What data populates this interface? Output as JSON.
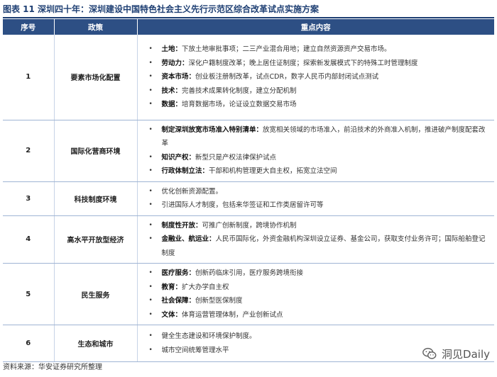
{
  "header": {
    "title": "图表 11  深圳四十年：深圳建设中国特色社会主义先行示范区综合改革试点实施方案"
  },
  "table": {
    "columns": [
      "序号",
      "政策",
      "重点内容"
    ],
    "rows": [
      {
        "no": "1",
        "policy": "要素市场化配置",
        "items": [
          {
            "bold": "土地：",
            "text": "下放土地审批事项；二三产业混合用地；建立自然资源资产交易市场。"
          },
          {
            "bold": "劳动力：",
            "text": "深化户籍制度改革；晚上居住证制度；探索新发展模式下的特殊工时管理制度"
          },
          {
            "bold": "资本市场：",
            "text": "创业板注册制改革，试点CDR，数字人民币内部封闭试点测试"
          },
          {
            "bold": "技术：",
            "text": "完善技术成果转化制度，建立分配机制"
          },
          {
            "bold": "数据：",
            "text": "培育数据市场，论证设立数据交易市场"
          }
        ]
      },
      {
        "no": "2",
        "policy": "国际化营商环境",
        "items": [
          {
            "bold": "制定深圳放宽市场准入特别清单：",
            "text": "放宽相关领域的市场准入，前沿技术的外商准入机制，推进破产制度配套改革"
          },
          {
            "bold": "知识产权：",
            "text": "新型只是产权法律保护试点"
          },
          {
            "bold": "行政体制立法：",
            "text": "干部和机构管理更大自主权，拓宽立法空间"
          }
        ]
      },
      {
        "no": "3",
        "policy": "科技制度环境",
        "items": [
          {
            "bold": "",
            "text": "优化创新资源配置。"
          },
          {
            "bold": "",
            "text": "引进国际人才制度，包括来华签证和工作类居留许可等"
          }
        ]
      },
      {
        "no": "4",
        "policy": "高水平开放型经济",
        "items": [
          {
            "bold": "制度性开放：",
            "text": "可推广创新制度，跨境协作机制"
          },
          {
            "bold": "金融业、航运业：",
            "text": "人民币国际化，外资金融机构深圳设立证券、基金公司，获取支付业务许可；国际船舶登记制度"
          }
        ]
      },
      {
        "no": "5",
        "policy": "民生服务",
        "items": [
          {
            "bold": "医疗服务：",
            "text": "创新药临床引用，医疗服务跨境衔接"
          },
          {
            "bold": "教育：",
            "text": "扩大办学自主权"
          },
          {
            "bold": "社会保障：",
            "text": "创新型医保制度"
          },
          {
            "bold": "文体：",
            "text": "体育运营管理体制，产业创新试点"
          }
        ]
      },
      {
        "no": "6",
        "policy": "生态和城市",
        "items": [
          {
            "bold": "",
            "text": "健全生态建设和环境保护制度。"
          },
          {
            "bold": "",
            "text": "城市空间统筹管理水平"
          }
        ]
      }
    ]
  },
  "source": "资料来源：华安证券研究所整理",
  "watermark": {
    "text": "洞见Daily",
    "icon": "wechat-icon"
  },
  "bullet_glyph": "•",
  "colors": {
    "header_bg": "#2d4f84",
    "title": "#1e3f73",
    "row_rule": "#9fb4d4"
  }
}
